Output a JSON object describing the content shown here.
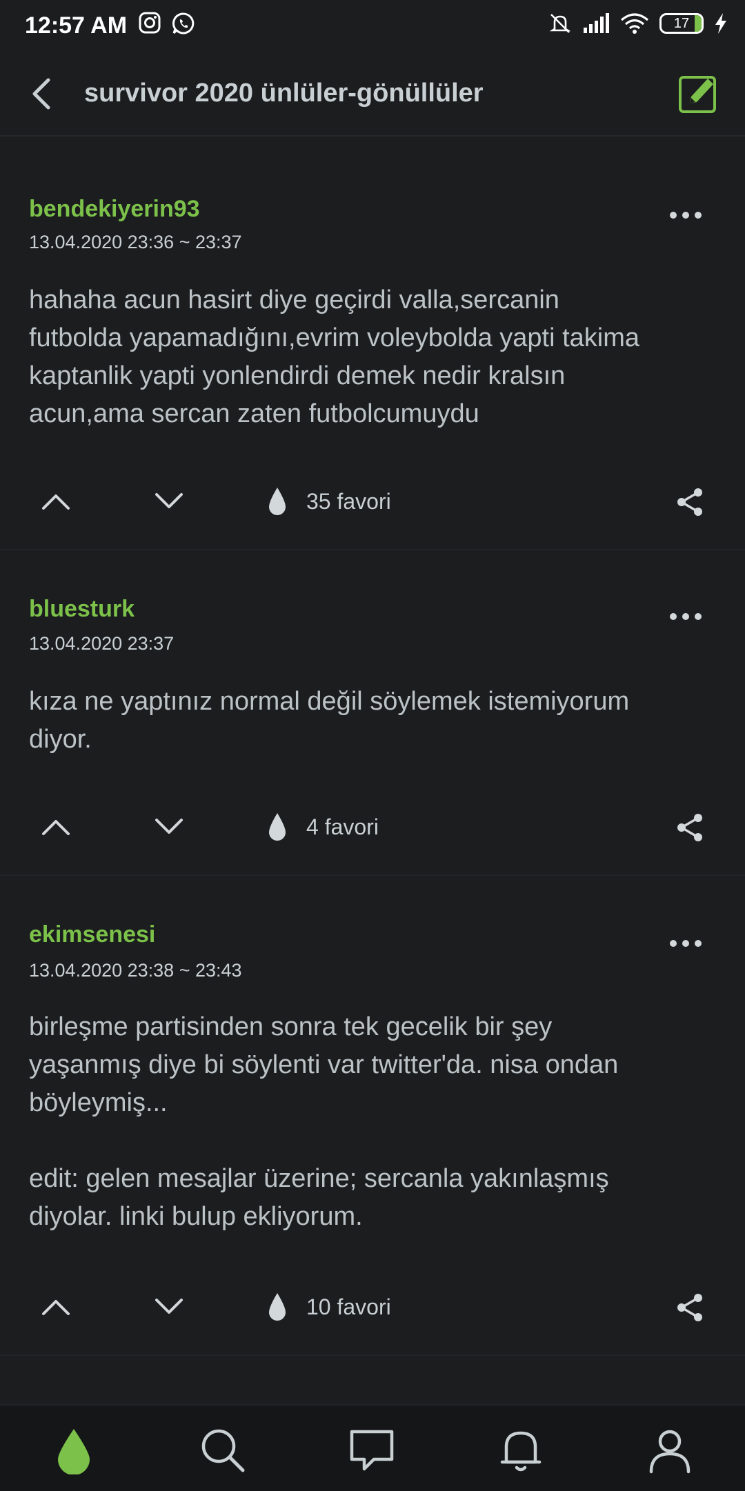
{
  "status": {
    "time": "12:57 AM",
    "battery": "17",
    "battery_level": 0.17,
    "left_icons": [
      "instagram-icon",
      "whatsapp-icon"
    ],
    "right_icons": [
      "mute-icon",
      "signal-icon",
      "wifi-icon",
      "battery-icon",
      "charging-icon"
    ]
  },
  "topbar": {
    "title": "survivor 2020 ünlüler-gönüllüler"
  },
  "colors": {
    "accent": "#7cc14a",
    "background": "#1c1d1f",
    "text": "#c9d0d4",
    "nav_background": "#151617"
  },
  "entries": [
    {
      "author": "bendekiyerin93",
      "date": "13.04.2020 23:36 ~ 23:37",
      "body": "hahaha acun hasirt diye geçirdi valla,sercanin\nfutbolda yapamadığını,evrim voleybolda yapti takima\nkaptanlik yapti yonlendirdi demek nedir kralsın\nacun,ama sercan zaten futbolcumuydu",
      "favorites": "35 favori"
    },
    {
      "author": "bluesturk",
      "date": "13.04.2020 23:37",
      "body": "kıza ne yaptınız normal değil söylemek istemiyorum\ndiyor.",
      "favorites": "4 favori"
    },
    {
      "author": "ekimsenesi",
      "date": "13.04.2020 23:38 ~ 23:43",
      "body": "birleşme partisinden sonra tek gecelik bir şey\nyaşanmış diye bi söylenti var twitter'da. nisa ondan\nböyleymiş...\n\nedit: gelen mesajlar üzerine; sercanla yakınlaşmış\ndiyolar. linki bulup ekliyorum.",
      "favorites": "10 favori"
    }
  ],
  "bottom_nav": [
    "drop-icon",
    "search-icon",
    "messages-icon",
    "notifications-icon",
    "profile-icon"
  ]
}
